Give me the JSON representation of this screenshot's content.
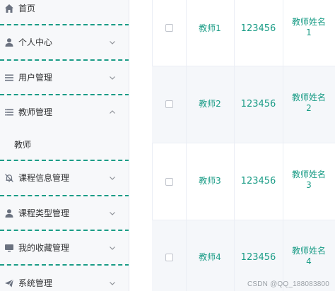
{
  "sidebar": {
    "items": [
      {
        "label": "首页",
        "icon": "home-icon"
      },
      {
        "label": "个人中心",
        "icon": "user-icon"
      },
      {
        "label": "用户管理",
        "icon": "list-icon"
      },
      {
        "label": "教师管理",
        "icon": "list-icon"
      },
      {
        "label": "课程信息管理",
        "icon": "bell-off-icon"
      },
      {
        "label": "课程类型管理",
        "icon": "user-icon"
      },
      {
        "label": "我的收藏管理",
        "icon": "monitor-icon"
      },
      {
        "label": "系统管理",
        "icon": "send-icon"
      }
    ],
    "submenu": {
      "label": "教师"
    }
  },
  "table": {
    "rows": [
      {
        "name": "教师1",
        "id": "123456",
        "full_name_1": "教师姓名",
        "full_name_2": "1"
      },
      {
        "name": "教师2",
        "id": "123456",
        "full_name_1": "教师姓名",
        "full_name_2": "2"
      },
      {
        "name": "教师3",
        "id": "123456",
        "full_name_1": "教师姓名",
        "full_name_2": "3"
      },
      {
        "name": "教师4",
        "id": "123456",
        "full_name_1": "教师姓名",
        "full_name_2": "4"
      }
    ]
  },
  "colors": {
    "accent": "#1a9c86",
    "text": "#303133",
    "stripe": "#f5f7fa"
  },
  "watermark": "CSDN @QQ_188083800"
}
